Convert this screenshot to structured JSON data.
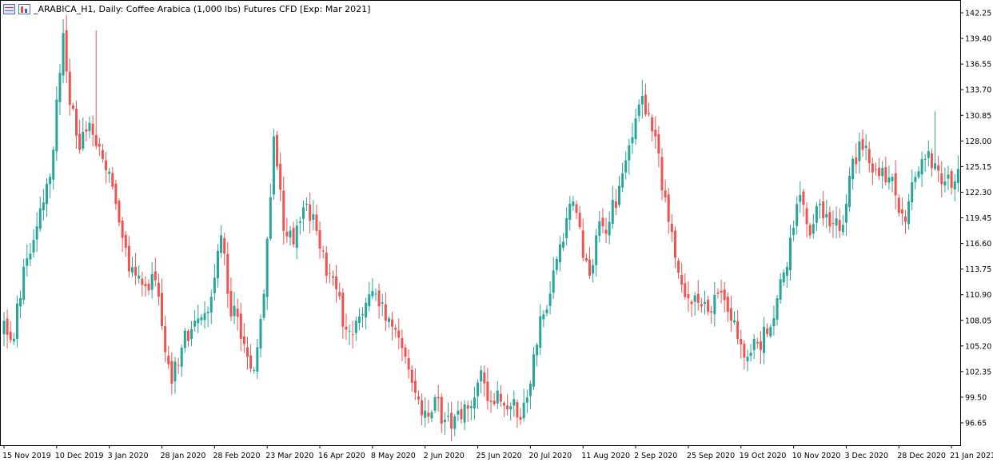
{
  "window": {
    "title": "_ARABICA_H1, Daily:  Coffee Arabica (1,000 lbs) Futures CFD [Exp: Mar 2021]",
    "icons": [
      "data-window-icon",
      "chart-properties-icon"
    ]
  },
  "colors": {
    "bull": "#26a69a",
    "bear": "#ef5350",
    "axis": "#000000",
    "background": "#ffffff"
  },
  "chart_data": {
    "type": "candlestick",
    "title": "_ARABICA_H1, Daily:  Coffee Arabica (1,000 lbs) Futures CFD [Exp: Mar 2021]",
    "ylim": [
      94.5,
      143.6
    ],
    "y_ticks": [
      "142.25",
      "139.40",
      "136.55",
      "133.70",
      "130.85",
      "128.00",
      "125.15",
      "122.30",
      "119.45",
      "116.60",
      "113.75",
      "110.90",
      "108.05",
      "105.20",
      "102.35",
      "99.50",
      "96.65"
    ],
    "x_ticks": [
      "15 Nov 2019",
      "10 Dec 2019",
      "3 Jan 2020",
      "28 Jan 2020",
      "28 Feb 2020",
      "23 Mar 2020",
      "16 Apr 2020",
      "8 May 2020",
      "2 Jun 2020",
      "25 Jun 2020",
      "20 Jul 2020",
      "11 Aug 2020",
      "2 Sep 2020",
      "25 Sep 2020",
      "19 Oct 2020",
      "10 Nov 2020",
      "3 Dec 2020",
      "28 Dec 2020",
      "21 Jan 2021"
    ],
    "x_tick_bar_index": [
      0,
      16,
      32,
      48,
      64,
      80,
      96,
      112,
      128,
      144,
      160,
      176,
      192,
      208,
      224,
      240,
      256,
      272,
      288
    ],
    "anchor_closes": [
      [
        0,
        108.0
      ],
      [
        3,
        106.0
      ],
      [
        6,
        114.0
      ],
      [
        10,
        118.5
      ],
      [
        14,
        124.0
      ],
      [
        18,
        140.0
      ],
      [
        20,
        132.0
      ],
      [
        23,
        127.0
      ],
      [
        26,
        130.0
      ],
      [
        30,
        126.0
      ],
      [
        34,
        121.0
      ],
      [
        38,
        113.5
      ],
      [
        42,
        112.0
      ],
      [
        46,
        112.5
      ],
      [
        49,
        104.5
      ],
      [
        51,
        101.0
      ],
      [
        54,
        105.0
      ],
      [
        58,
        108.0
      ],
      [
        62,
        109.0
      ],
      [
        66,
        117.5
      ],
      [
        68,
        111.0
      ],
      [
        72,
        106.0
      ],
      [
        74,
        104.0
      ],
      [
        76,
        102.5
      ],
      [
        79,
        111.0
      ],
      [
        82,
        128.5
      ],
      [
        85,
        118.0
      ],
      [
        88,
        116.5
      ],
      [
        92,
        121.0
      ],
      [
        95,
        118.0
      ],
      [
        98,
        113.0
      ],
      [
        101,
        111.5
      ],
      [
        104,
        107.0
      ],
      [
        107,
        108.0
      ],
      [
        110,
        110.0
      ],
      [
        113,
        111.0
      ],
      [
        116,
        108.0
      ],
      [
        119,
        107.0
      ],
      [
        122,
        104.0
      ],
      [
        125,
        100.0
      ],
      [
        128,
        98.0
      ],
      [
        131,
        99.5
      ],
      [
        134,
        97.0
      ],
      [
        136,
        96.0
      ],
      [
        138,
        98.0
      ],
      [
        142,
        98.5
      ],
      [
        145,
        102.5
      ],
      [
        148,
        99.0
      ],
      [
        151,
        99.0
      ],
      [
        154,
        98.5
      ],
      [
        157,
        97.0
      ],
      [
        160,
        101.0
      ],
      [
        163,
        108.5
      ],
      [
        166,
        111.0
      ],
      [
        169,
        116.5
      ],
      [
        172,
        121.0
      ],
      [
        174,
        120.0
      ],
      [
        176,
        115.0
      ],
      [
        178,
        113.0
      ],
      [
        180,
        117.5
      ],
      [
        184,
        119.0
      ],
      [
        187,
        123.0
      ],
      [
        190,
        127.5
      ],
      [
        192,
        130.5
      ],
      [
        194,
        133.0
      ],
      [
        196,
        131.0
      ],
      [
        198,
        128.5
      ],
      [
        200,
        122.5
      ],
      [
        202,
        119.0
      ],
      [
        204,
        115.0
      ],
      [
        206,
        112.0
      ],
      [
        208,
        110.5
      ],
      [
        211,
        110.0
      ],
      [
        214,
        109.0
      ],
      [
        217,
        111.0
      ],
      [
        220,
        109.0
      ],
      [
        223,
        106.0
      ],
      [
        226,
        104.0
      ],
      [
        229,
        105.5
      ],
      [
        232,
        106.5
      ],
      [
        235,
        110.5
      ],
      [
        238,
        114.0
      ],
      [
        242,
        122.0
      ],
      [
        245,
        117.5
      ],
      [
        248,
        121.0
      ],
      [
        251,
        118.5
      ],
      [
        254,
        118.0
      ],
      [
        256,
        121.0
      ],
      [
        258,
        126.0
      ],
      [
        261,
        127.0
      ],
      [
        264,
        124.5
      ],
      [
        267,
        125.0
      ],
      [
        270,
        124.0
      ],
      [
        272,
        120.0
      ],
      [
        274,
        119.0
      ],
      [
        277,
        124.0
      ],
      [
        280,
        126.0
      ],
      [
        283,
        125.5
      ],
      [
        286,
        123.5
      ],
      [
        289,
        123.5
      ],
      [
        292,
        124.0
      ],
      [
        294,
        124.0
      ]
    ],
    "notable_highs": [
      [
        19,
        142.0
      ],
      [
        28,
        140.3
      ],
      [
        194,
        134.8
      ],
      [
        283,
        131.3
      ]
    ],
    "notable_lows": [
      [
        51,
        99.8
      ],
      [
        136,
        94.6
      ],
      [
        230,
        103.2
      ]
    ]
  }
}
